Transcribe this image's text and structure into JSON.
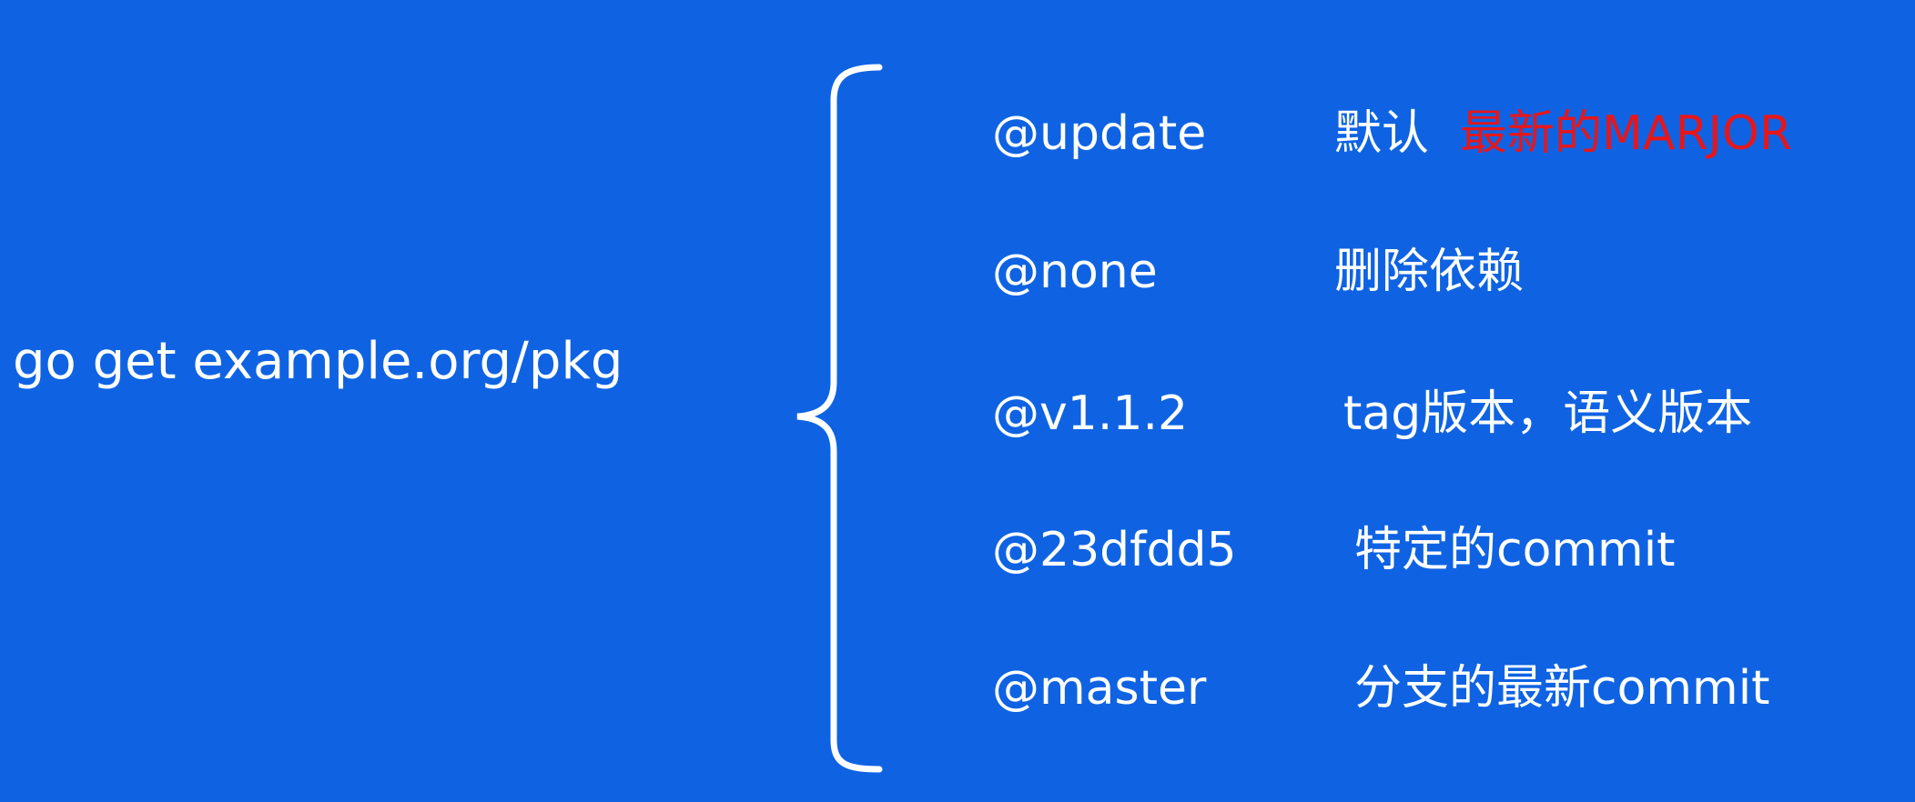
{
  "command": "go get example.org/pkg",
  "items": [
    {
      "tag": "@update",
      "desc": "默认",
      "desc_note": "最新的MARJOR"
    },
    {
      "tag": "@none",
      "desc": "删除依赖"
    },
    {
      "tag": "@v1.1.2",
      "desc": "tag版本，语义版本"
    },
    {
      "tag": "@23dfdd5",
      "desc": "特定的commit"
    },
    {
      "tag": "@master",
      "desc": "分支的最新commit"
    }
  ],
  "colors": {
    "background": "#0f63e3",
    "text": "#ffffff",
    "highlight": "#e5171b"
  }
}
